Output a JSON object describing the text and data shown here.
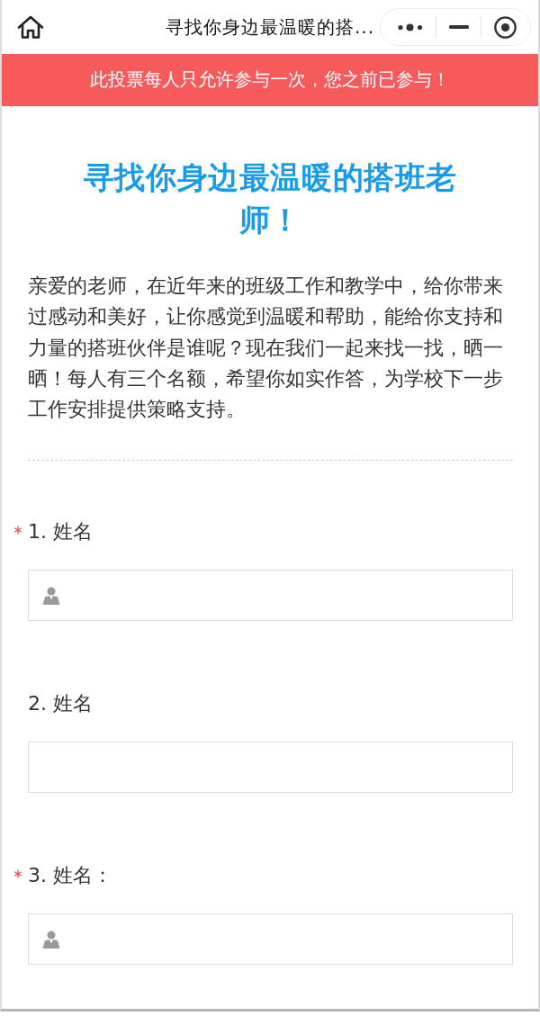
{
  "nav_bar": {
    "title": "寻找你身边最温暖的搭..."
  },
  "notice_banner": {
    "text": "此投票每人只允许参与一次，您之前已参与！"
  },
  "survey": {
    "title": "寻找你身边最温暖的搭班老师！",
    "intro": "亲爱的老师，在近年来的班级工作和教学中，给你带来过感动和美好，让你感觉到温暖和帮助，能给你支持和力量的搭班伙伴是谁呢？现在我们一起来找一找，晒一晒！每人有三个名额，希望你如实作答，为学校下一步工作安排提供策略支持。"
  },
  "questions": [
    {
      "label": "1. 姓名",
      "required": true,
      "kind": "person"
    },
    {
      "label": "2. 姓名",
      "required": false,
      "kind": "plain"
    },
    {
      "label": "3. 姓名：",
      "required": true,
      "kind": "person"
    }
  ]
}
